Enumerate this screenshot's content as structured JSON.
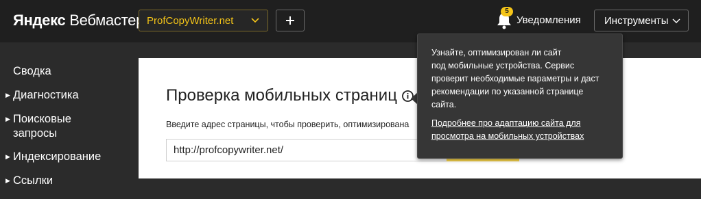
{
  "header": {
    "logo_bold": "Яндекс",
    "logo_light": "Вебмастер",
    "site_selector": "ProfCopyWriter.net",
    "add_button": "+",
    "notifications_count": "5",
    "notifications_label": "Уведомления",
    "tools_label": "Инструменты"
  },
  "sidebar": {
    "items": [
      {
        "label_1": "Сводка",
        "label_2": "",
        "expandable": false
      },
      {
        "label_1": "Диагностика",
        "label_2": "",
        "expandable": true
      },
      {
        "label_1": "Поисковые",
        "label_2": "запросы",
        "expandable": true
      },
      {
        "label_1": "Индексирование",
        "label_2": "",
        "expandable": true
      },
      {
        "label_1": "Ссылки",
        "label_2": "",
        "expandable": true
      }
    ]
  },
  "main": {
    "title": "Проверка мобильных страниц",
    "description": "Введите адрес страницы, чтобы проверить, оптимизирована",
    "url_value": "http://profcopywriter.net/"
  },
  "tooltip": {
    "lines": [
      "Узнайте, оптимизирован ли сайт",
      "под мобильные устройства. Сервис",
      "проверит необходимые параметры и даст",
      "рекомендации по указанной странице",
      "сайта."
    ],
    "link_lines": [
      "Подробнее про адаптацию сайта для",
      "просмотра на мобильных устройствах"
    ]
  },
  "colors": {
    "accent_yellow": "#f5c518",
    "button_yellow": "#ffdb4d",
    "topbar": "#1f1f1f",
    "sidebar": "#2b2b2b",
    "tooltip": "#363636"
  },
  "icons": [
    "chevron-down-icon",
    "plus-icon",
    "bell-icon",
    "info-icon",
    "triangle-right-icon"
  ]
}
